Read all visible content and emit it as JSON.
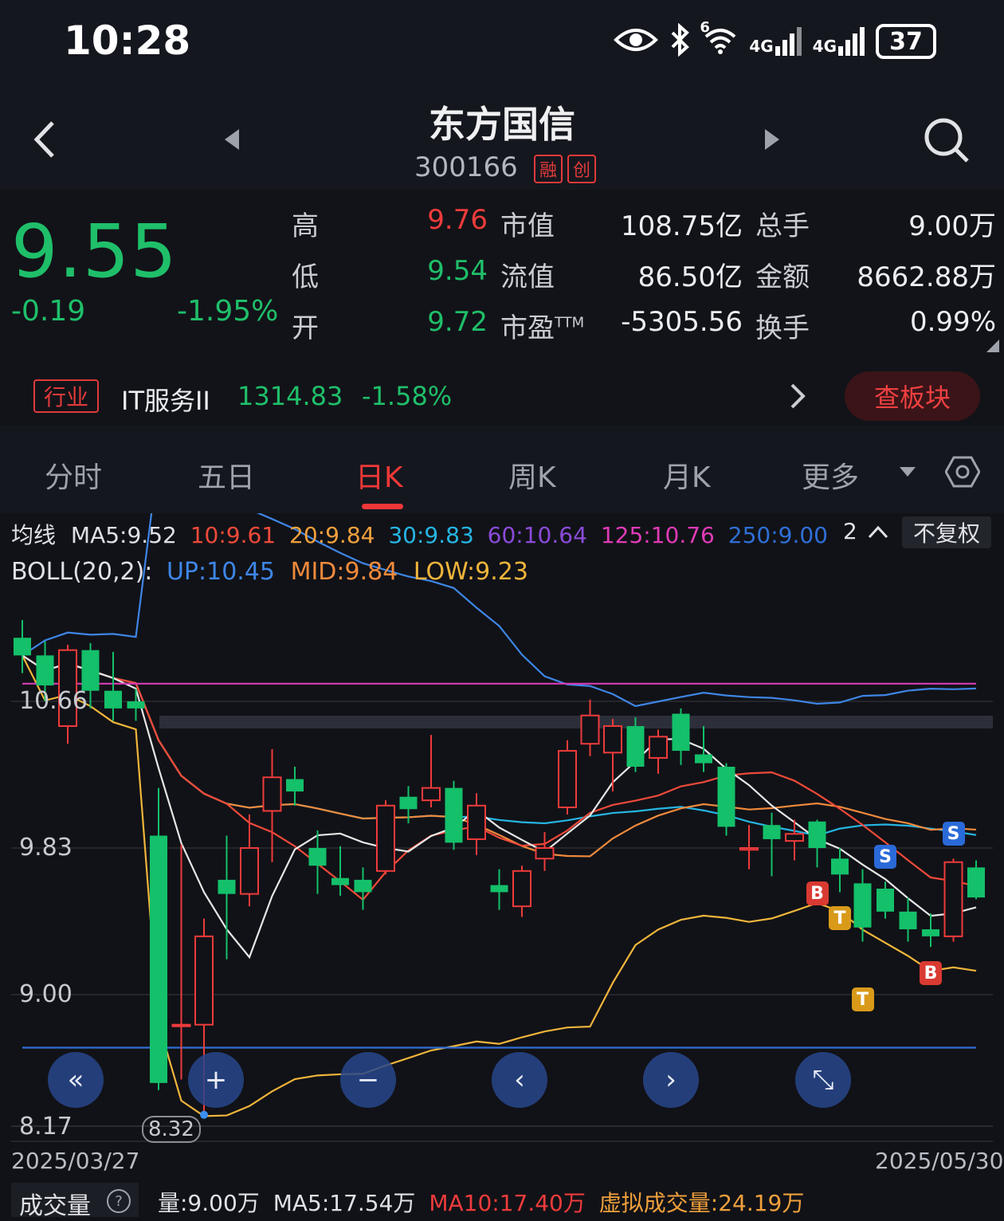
{
  "status_bar": {
    "time": "10:28",
    "network_6": "6",
    "network_4g_1": "4G",
    "network_4g_2": "4G",
    "battery": "37",
    "icons": [
      "eye-icon",
      "bluetooth-icon",
      "wifi-icon",
      "signal-icon",
      "signal-icon",
      "battery-icon"
    ]
  },
  "header": {
    "name": "东方国信",
    "code": "300166",
    "tag1": "融",
    "tag2": "创"
  },
  "quote": {
    "price": "9.55",
    "change": "-0.19",
    "change_pct": "-1.95%",
    "high_label": "高",
    "high": "9.76",
    "low_label": "低",
    "low": "9.54",
    "open_label": "开",
    "open": "9.72",
    "mcap_label": "市值",
    "mcap": "108.75亿",
    "float_label": "流值",
    "float": "86.50亿",
    "pe_label": "市盈",
    "pe_sup": "TTM",
    "pe": "-5305.56",
    "vol_label": "总手",
    "vol": "9.00万",
    "amount_label": "金额",
    "amount": "8662.88万",
    "turnover_label": "换手",
    "turnover": "0.99%"
  },
  "industry": {
    "tag": "行业",
    "name": "IT服务II",
    "value": "1314.83",
    "pct": "-1.58%",
    "button": "查板块"
  },
  "tabs": [
    "分时",
    "五日",
    "日K",
    "周K",
    "月K",
    "更多"
  ],
  "active_tab": "日K",
  "indicators": {
    "ma_title": "均线",
    "ma5": "MA5:9.52",
    "ma10": "10:9.61",
    "ma20": "20:9.84",
    "ma30": "30:9.83",
    "ma60": "60:10.64",
    "ma125": "125:10.76",
    "ma250": "250:9.00",
    "expand": "2",
    "adjust": "不复权",
    "boll_title": "BOLL(20,2):",
    "boll_up": "UP:10.45",
    "boll_mid": "MID:9.84",
    "boll_low": "LOW:9.23",
    "colors": {
      "ma5": "#e6e6e6",
      "ma10": "#ef4a3a",
      "ma20": "#f08a3c",
      "ma30": "#26b5e3",
      "ma60": "#8a4bd8",
      "ma125": "#d83bb6",
      "ma250": "#2f6fd6",
      "boll_up": "#3e86e6",
      "boll_low": "#f0b53b"
    }
  },
  "chart_data": {
    "type": "candlestick",
    "y_ticks": [
      "10.66",
      "9.83",
      "9.00",
      "8.17"
    ],
    "ylim": [
      8.17,
      11.5
    ],
    "date_start": "2025/03/27",
    "date_end": "2025/05/30",
    "low_marker": "8.32",
    "candles": [
      {
        "o": 11.02,
        "c": 10.92,
        "h": 11.12,
        "l": 10.82
      },
      {
        "o": 10.92,
        "c": 10.75,
        "h": 11.0,
        "l": 10.66
      },
      {
        "o": 10.52,
        "c": 10.95,
        "h": 10.98,
        "l": 10.42
      },
      {
        "o": 10.95,
        "c": 10.72,
        "h": 10.99,
        "l": 10.62
      },
      {
        "o": 10.72,
        "c": 10.62,
        "h": 10.94,
        "l": 10.55
      },
      {
        "o": 10.66,
        "c": 10.62,
        "h": 10.73,
        "l": 10.55
      },
      {
        "o": 9.9,
        "c": 8.5,
        "h": 10.17,
        "l": 8.46
      },
      {
        "o": 8.83,
        "c": 8.83,
        "h": 9.85,
        "l": 8.52
      },
      {
        "o": 8.83,
        "c": 9.33,
        "h": 9.43,
        "l": 8.32
      },
      {
        "o": 9.65,
        "c": 9.57,
        "h": 9.9,
        "l": 9.2
      },
      {
        "o": 9.57,
        "c": 9.83,
        "h": 10.02,
        "l": 9.5
      },
      {
        "o": 10.04,
        "c": 10.23,
        "h": 10.39,
        "l": 9.75
      },
      {
        "o": 10.22,
        "c": 10.15,
        "h": 10.29,
        "l": 10.07
      },
      {
        "o": 9.83,
        "c": 9.73,
        "h": 9.93,
        "l": 9.57
      },
      {
        "o": 9.66,
        "c": 9.62,
        "h": 9.84,
        "l": 9.56
      },
      {
        "o": 9.65,
        "c": 9.58,
        "h": 9.72,
        "l": 9.48
      },
      {
        "o": 9.7,
        "c": 10.07,
        "h": 10.1,
        "l": 9.68
      },
      {
        "o": 10.12,
        "c": 10.05,
        "h": 10.18,
        "l": 9.97
      },
      {
        "o": 10.1,
        "c": 10.17,
        "h": 10.47,
        "l": 10.06
      },
      {
        "o": 10.17,
        "c": 9.86,
        "h": 10.21,
        "l": 9.82
      },
      {
        "o": 9.88,
        "c": 10.07,
        "h": 10.14,
        "l": 9.79
      },
      {
        "o": 9.62,
        "c": 9.58,
        "h": 9.71,
        "l": 9.48
      },
      {
        "o": 9.5,
        "c": 9.7,
        "h": 9.73,
        "l": 9.44
      },
      {
        "o": 9.77,
        "c": 9.83,
        "h": 9.92,
        "l": 9.7
      },
      {
        "o": 10.06,
        "c": 10.38,
        "h": 10.44,
        "l": 10.02
      },
      {
        "o": 10.42,
        "c": 10.58,
        "h": 10.67,
        "l": 10.35
      },
      {
        "o": 10.37,
        "c": 10.52,
        "h": 10.56,
        "l": 10.15
      },
      {
        "o": 10.52,
        "c": 10.29,
        "h": 10.57,
        "l": 10.26
      },
      {
        "o": 10.34,
        "c": 10.46,
        "h": 10.5,
        "l": 10.25
      },
      {
        "o": 10.59,
        "c": 10.38,
        "h": 10.62,
        "l": 10.3
      },
      {
        "o": 10.36,
        "c": 10.31,
        "h": 10.52,
        "l": 10.26
      },
      {
        "o": 10.29,
        "c": 9.95,
        "h": 10.31,
        "l": 9.9
      },
      {
        "o": 9.82,
        "c": 9.83,
        "h": 9.96,
        "l": 9.71
      },
      {
        "o": 9.96,
        "c": 9.88,
        "h": 10.03,
        "l": 9.67
      },
      {
        "o": 9.87,
        "c": 9.91,
        "h": 9.99,
        "l": 9.76
      },
      {
        "o": 9.98,
        "c": 9.83,
        "h": 9.99,
        "l": 9.72
      },
      {
        "o": 9.77,
        "c": 9.68,
        "h": 9.83,
        "l": 9.58
      },
      {
        "o": 9.63,
        "c": 9.38,
        "h": 9.71,
        "l": 9.3
      },
      {
        "o": 9.6,
        "c": 9.47,
        "h": 9.64,
        "l": 9.43
      },
      {
        "o": 9.47,
        "c": 9.37,
        "h": 9.55,
        "l": 9.3
      },
      {
        "o": 9.37,
        "c": 9.33,
        "h": 9.46,
        "l": 9.27
      },
      {
        "o": 9.33,
        "c": 9.75,
        "h": 9.77,
        "l": 9.3
      },
      {
        "o": 9.72,
        "c": 9.55,
        "h": 9.76,
        "l": 9.54
      }
    ],
    "signals": [
      {
        "label": "B",
        "color": "#d93a32",
        "candle": 35
      },
      {
        "label": "T",
        "color": "#d99a1a",
        "candle": 36
      },
      {
        "label": "T",
        "color": "#d99a1a",
        "candle": 37
      },
      {
        "label": "S",
        "color": "#2a6ad8",
        "candle": 38
      },
      {
        "label": "B",
        "color": "#d93a32",
        "candle": 40
      },
      {
        "label": "S",
        "color": "#2a6ad8",
        "candle": 41
      }
    ]
  },
  "controls": {
    "icons": [
      "rewind-icon",
      "zoom-in-icon",
      "zoom-out-icon",
      "prev-icon",
      "next-icon",
      "fullscreen-icon"
    ],
    "rewind": "«",
    "zoom_in": "+",
    "zoom_out": "−",
    "prev": "‹",
    "next": "›",
    "fullscreen": "⤡"
  },
  "volume": {
    "title": "成交量",
    "help": "?",
    "vol": "量:9.00万",
    "ma5": "MA5:17.54万",
    "ma10": "MA10:17.40万",
    "virtual": "虚拟成交量:24.19万"
  }
}
